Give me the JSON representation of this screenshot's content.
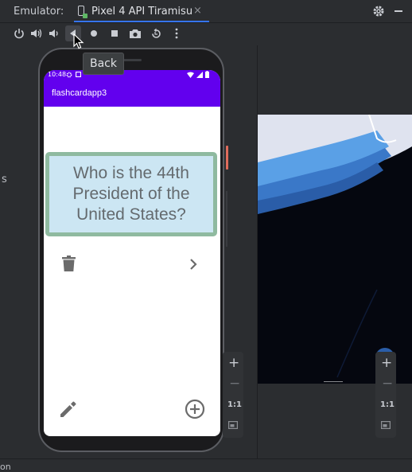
{
  "window": {
    "title": "Emulator:",
    "tab_label": "Pixel 4 API Tiramisu",
    "tab_close": "×"
  },
  "tooltip": {
    "text": "Back"
  },
  "toolbar": {
    "buttons": [
      "power",
      "volume-up",
      "volume-down",
      "back",
      "home",
      "overview",
      "screenshot",
      "rotate",
      "more"
    ]
  },
  "device": {
    "status_time": "10:48",
    "app_title": "flashcardapp3",
    "card_question": "Who is the 44th President of the United States?",
    "colors": {
      "appbar": "#6200ee",
      "card_bg": "#cce6f3",
      "card_border": "#8fbaa0"
    }
  },
  "zoom_controls": {
    "plus": "+",
    "minus": "−",
    "one_to_one": "1:1"
  },
  "left_fragment": "s",
  "bottom_fragment": "on"
}
